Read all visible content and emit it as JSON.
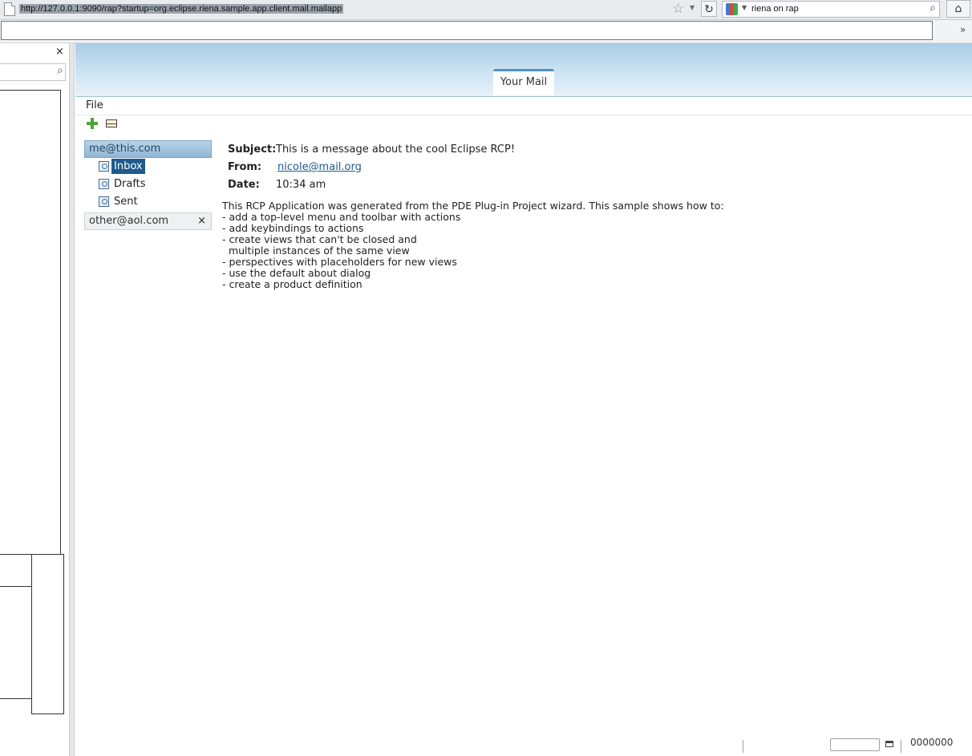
{
  "browser": {
    "url": "http://127.0.0.1:9090/rap?startup=org.eclipse.riena.sample.app.client.mail.mailapp",
    "search_text": "riena on rap"
  },
  "app": {
    "tab_label": "Your Mail",
    "menu": {
      "file": "File"
    },
    "navigation": {
      "accounts": [
        {
          "label": "me@this.com",
          "items": [
            "Inbox",
            "Drafts",
            "Sent"
          ],
          "selected": "Inbox"
        },
        {
          "label": "other@aol.com"
        }
      ]
    },
    "message": {
      "subject_label": "Subject:",
      "subject": "This is a message about the cool Eclipse RCP!",
      "from_label": "From:",
      "from": "nicole@mail.org",
      "date_label": "Date:",
      "date": "10:34 am",
      "body": "This RCP Application was generated from the PDE Plug-in Project wizard. This sample shows how to:\n- add a top-level menu and toolbar with actions\n- add keybindings to actions\n- create views that can't be closed and\n  multiple instances of the same view\n- perspectives with placeholders for new views\n- use the default about dialog\n- create a product definition"
    },
    "status": {
      "text": "0000000"
    }
  },
  "icons": {
    "close": "×",
    "star": "☆",
    "reload": "↻",
    "home": "⌂",
    "chevron": "»",
    "search": "⌕"
  },
  "colors": {
    "accent": "#1e5a8e",
    "banner_top": "#a8cde6",
    "banner_bottom": "#e8f2f9"
  }
}
